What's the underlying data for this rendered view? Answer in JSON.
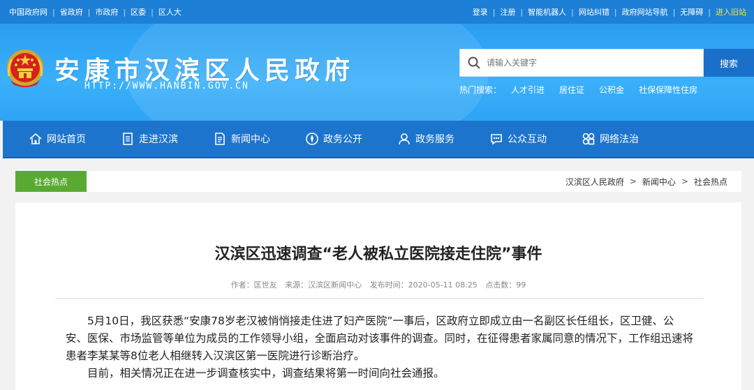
{
  "topbar": {
    "left_links": [
      "中国政府网",
      "省政府",
      "市政府",
      "区委",
      "区人大"
    ],
    "right_links": [
      "登录",
      "注册",
      "智能机器人",
      "网站纠错",
      "政府网站导航",
      "无障碍"
    ],
    "old_site": "进入旧站"
  },
  "header": {
    "title": "安康市汉滨区人民政府",
    "url": "HTTP://WWW.HANBIN.GOV.CN",
    "search_placeholder": "请输入关键字",
    "search_button": "搜索",
    "hot_label": "热门搜索：",
    "hot_items": [
      "人才引进",
      "居住证",
      "公积金",
      "社保保障性住房"
    ]
  },
  "nav": {
    "items": [
      {
        "label": "网站首页",
        "icon": "home-icon"
      },
      {
        "label": "走进汉滨",
        "icon": "document-icon"
      },
      {
        "label": "新闻中心",
        "icon": "news-icon"
      },
      {
        "label": "政务公开",
        "icon": "compass-icon"
      },
      {
        "label": "政务服务",
        "icon": "user-icon"
      },
      {
        "label": "公众互动",
        "icon": "chat-icon"
      },
      {
        "label": "网络法治",
        "icon": "network-icon"
      }
    ]
  },
  "breadcrumb": {
    "section_tag": "社会热点",
    "items": [
      "汉滨区人民政府",
      "新闻中心",
      "社会热点"
    ],
    "separator": ">"
  },
  "article": {
    "title": "汉滨区迅速调查“老人被私立医院接走住院”事件",
    "meta": {
      "author": "作者：匡世友",
      "source": "来源：汉滨区新闻中心",
      "published": "发布时间：2020-05-11 08:25",
      "views": "点击数：99"
    },
    "paragraphs": [
      "5月10日，我区获悉“安康78岁老汉被悄悄接走住进了妇产医院”一事后，区政府立即成立由一名副区长任组长，区卫健、公安、医保、市场监管等单位为成员的工作领导小组，全面启动对该事件的调查。同时，在征得患者家属同意的情况下，工作组迅速将患者李某某等8位老人相继转入汉滨区第一医院进行诊断治疗。",
      "目前，相关情况正在进一步调查核实中，调查结果将第一时间向社会通报。"
    ]
  },
  "colors": {
    "topbar": "#1d80d6",
    "header": "#2ea4f4",
    "nav": "#1c74cc",
    "search_button": "#1a6fc9",
    "section_tag": "#5aaa32",
    "highlight": "#ffe14a"
  }
}
